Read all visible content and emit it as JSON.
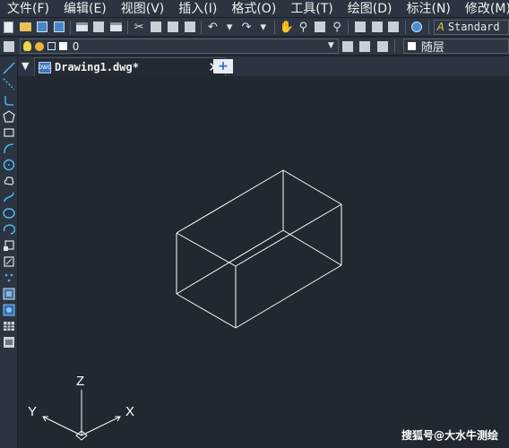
{
  "menu": {
    "items": [
      "文件(F)",
      "编辑(E)",
      "视图(V)",
      "插入(I)",
      "格式(O)",
      "工具(T)",
      "绘图(D)",
      "标注(N)",
      "修改(M)"
    ]
  },
  "toolbar": {
    "text_style": "Standard"
  },
  "layer_bar": {
    "current_layer": "0",
    "color_value": "随层"
  },
  "document": {
    "tab_title": "Drawing1.dwg*",
    "icon_text": "DWG"
  },
  "ucs": {
    "x_label": "X",
    "y_label": "Y",
    "z_label": "Z"
  },
  "watermark": "搜狐号@大水牛测绘",
  "colors": {
    "canvas_bg": "#212830",
    "ui_bg": "#2b3440",
    "geometry": "#ffffff",
    "tool_icon": "#4fb8e8"
  }
}
